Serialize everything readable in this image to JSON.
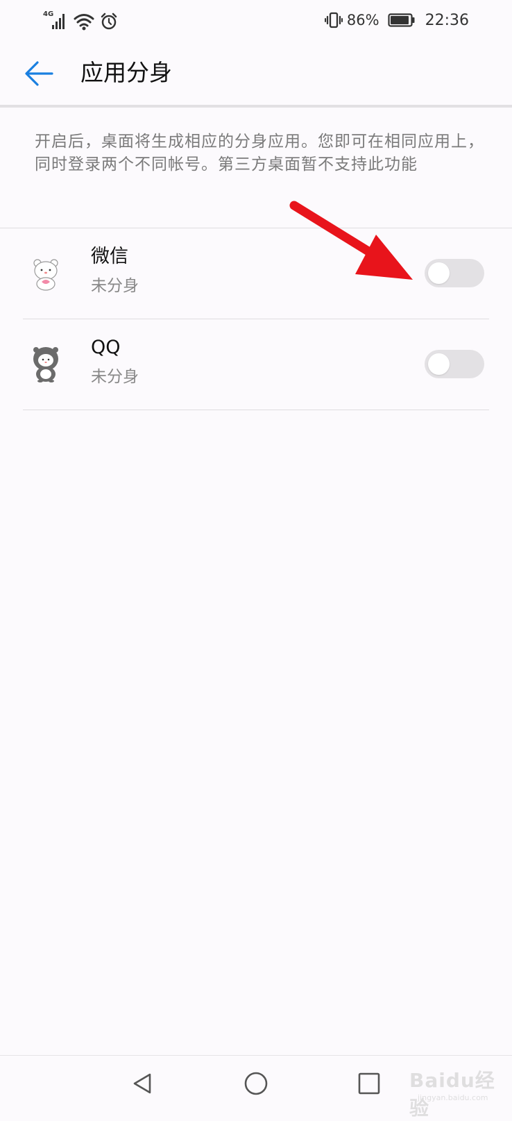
{
  "status_bar": {
    "network_label": "4G",
    "battery_percent": "86%",
    "time": "22:36",
    "icons": [
      "signal-icon",
      "wifi-icon",
      "alarm-icon",
      "vibrate-icon",
      "battery-icon"
    ],
    "battery_level": 0.86
  },
  "header": {
    "title": "应用分身",
    "back_icon": "arrow-left-icon",
    "accent_color": "#1a7fe0"
  },
  "description": "开启后，桌面将生成相应的分身应用。您即可在相同应用上，同时登录两个不同帐号。第三方桌面暂不支持此功能",
  "apps": [
    {
      "name": "微信",
      "status": "未分身",
      "enabled": false,
      "icon": "wechat-bear-icon"
    },
    {
      "name": "QQ",
      "status": "未分身",
      "enabled": false,
      "icon": "qq-bear-icon"
    }
  ],
  "annotation": {
    "color": "#e8141b",
    "icon": "red-arrow-icon"
  },
  "nav_bar": {
    "buttons": [
      "nav-back-icon",
      "nav-home-icon",
      "nav-recent-icon"
    ]
  },
  "watermark": {
    "text": "Baidu经验",
    "subtext": "jingyan.baidu.com"
  }
}
